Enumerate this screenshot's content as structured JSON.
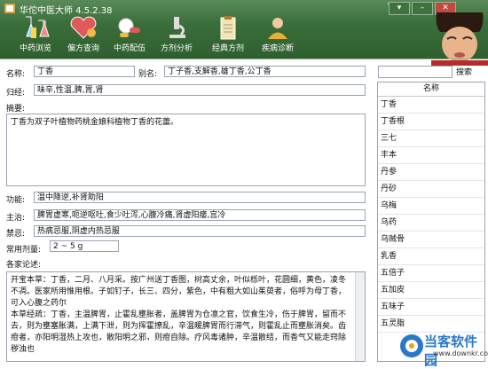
{
  "window": {
    "title": "华佗中医大师 4.5.2.38"
  },
  "toolbar": [
    {
      "label": "中药浏览",
      "icon": "flask-icon"
    },
    {
      "label": "偏方查询",
      "icon": "heart-icon"
    },
    {
      "label": "中药配伍",
      "icon": "pills-icon"
    },
    {
      "label": "方剂分析",
      "icon": "microscope-icon"
    },
    {
      "label": "经典方剂",
      "icon": "clipboard-icon"
    },
    {
      "label": "疾病诊断",
      "icon": "doctor-icon"
    }
  ],
  "form": {
    "name_label": "名称:",
    "name_value": "丁香",
    "alias_label": "别名:",
    "alias_value": "丁子香,支解香,雄丁香,公丁香",
    "meridian_label": "归经:",
    "meridian_value": "味辛,性温,脾,胃,肾",
    "summary_label": "摘要:",
    "summary_text": "丁香为双子叶植物药桃金娘科植物丁香的花蕾。",
    "function_label": "功能:",
    "function_value": "温中降逆,补肾助阳",
    "indication_label": "主治:",
    "indication_value": "脾胃虚寒,呃逆呕吐,食少吐泻,心腹冷痛,肾虚阳痿,宫冷",
    "contra_label": "禁忌:",
    "contra_value": "热病忌服,阴虚内热忌服",
    "dose_label": "常用剂量:",
    "dose_value": "2 ~ 5 g",
    "commentary_label": "各家论述:",
    "commentary_text": "开宝本草：丁香，二月、八月采。按广州送丁香图，树高丈余，叶似栎叶，花圆细，黄色，凌冬不凋。医家所用惟用根。子如钉子，长三、四分，紫色，中有粗大如山茱萸者，俗呼为母丁香，可入心腹之药尔\n本草经疏：丁香，主温脾胃，止霍乱壅胀者，盖脾胃为仓凛之官，饮食生冷，伤于脾胃，留而不去，则为壅塞胀满，上满下泄，则为挥霍撩乱，辛温暖脾胃而行滞气，则霍乱止而壅胀消矣。齿疳者，亦阳明湿热上攻也，散阳明之邪，则疳自除。疗风毒诸肿，辛温散结，而香气又能走窍除秽浊也"
  },
  "search": {
    "button_label": "搜索",
    "value": ""
  },
  "list": {
    "header": "名称",
    "items": [
      "丁香",
      "丁香根",
      "三七",
      "丰本",
      "丹参",
      "丹砂",
      "乌梅",
      "乌药",
      "乌贼骨",
      "乳香",
      "五倍子",
      "五加皮",
      "五味子",
      "五灵脂"
    ]
  },
  "watermark": {
    "line1": "当客软件园",
    "line2": "www.downkr.com"
  },
  "colors": {
    "header_bg": "#3a6e3a",
    "accent": "#2a78c8"
  }
}
